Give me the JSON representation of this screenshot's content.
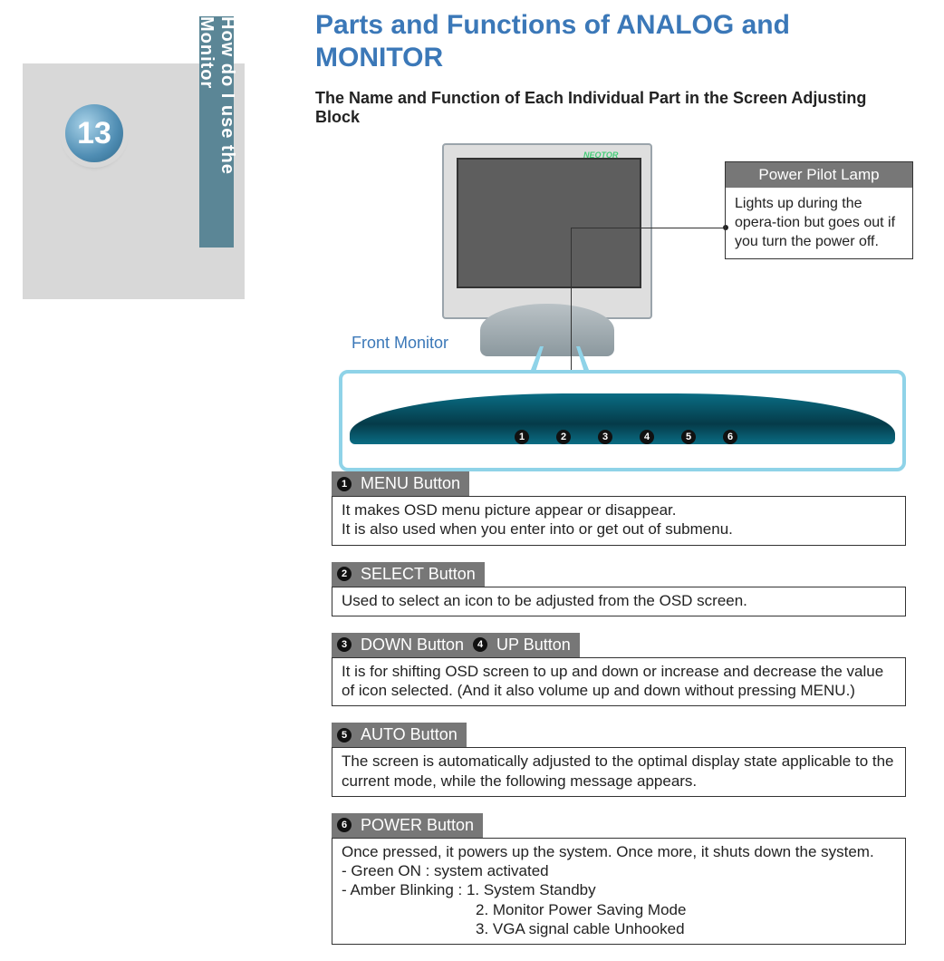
{
  "sidebar": {
    "tab_label": "How do I use the Monitor",
    "page_number": "13"
  },
  "title": "Parts and Functions of ANALOG and MONITOR",
  "subtitle": "The Name and Function of Each Individual Part in the Screen Adjusting Block",
  "front_monitor_label": "Front Monitor",
  "brand": "NEOTOR",
  "callout": {
    "title": "Power Pilot Lamp",
    "body": "Lights up during the opera-tion but goes out if you turn the power off."
  },
  "strip_numbers": [
    "1",
    "2",
    "3",
    "4",
    "5",
    "6"
  ],
  "sections": [
    {
      "head_parts": [
        {
          "n": "1",
          "label": "MENU Button"
        }
      ],
      "body": "It makes OSD menu picture appear or disappear.\nIt is also used when you enter into or get out of submenu."
    },
    {
      "head_parts": [
        {
          "n": "2",
          "label": "SELECT Button"
        }
      ],
      "body": "Used to select an icon to be adjusted from the OSD screen."
    },
    {
      "head_parts": [
        {
          "n": "3",
          "label": "DOWN Button"
        },
        {
          "n": "4",
          "label": "UP Button"
        }
      ],
      "body": "It is for shifting OSD screen to up and down or increase and decrease  the value of icon selected.  (And  it also volume up and down without pressing MENU.)"
    },
    {
      "head_parts": [
        {
          "n": "5",
          "label": "AUTO Button"
        }
      ],
      "body": "The screen is  automatically adjusted to the optimal display state applicable to the current mode, while the following message appears."
    },
    {
      "head_parts": [
        {
          "n": "6",
          "label": "POWER Button"
        }
      ],
      "body_lines": [
        "Once pressed, it powers up the system. Once more, it shuts down the system.",
        "- Green ON : system activated",
        "- Amber Blinking : 1. System Standby",
        "2. Monitor Power Saving Mode",
        "3. VGA signal cable Unhooked"
      ],
      "indent_from": 3
    }
  ]
}
